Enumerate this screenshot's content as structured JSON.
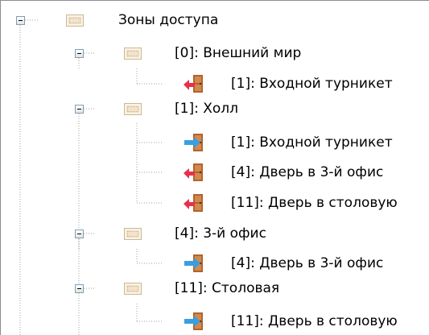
{
  "tree": {
    "root": {
      "label": "Зоны доступа"
    },
    "zones": [
      {
        "label": "[0]: Внешний мир",
        "doors": [
          {
            "label": "[1]: Входной турникет",
            "direction": "exit"
          }
        ]
      },
      {
        "label": "[1]: Холл",
        "doors": [
          {
            "label": "[1]: Входной турникет",
            "direction": "enter"
          },
          {
            "label": "[4]: Дверь в 3-й офис",
            "direction": "exit"
          },
          {
            "label": "[11]: Дверь в столовую",
            "direction": "exit"
          }
        ]
      },
      {
        "label": "[4]: 3-й офис",
        "doors": [
          {
            "label": "[4]: Дверь в 3-й офис",
            "direction": "enter"
          }
        ]
      },
      {
        "label": "[11]: Столовая",
        "doors": [
          {
            "label": "[11]: Дверь в столовую",
            "direction": "enter"
          }
        ]
      }
    ]
  },
  "colors": {
    "enter_arrow": "#3a9ee0",
    "exit_arrow": "#e8304a",
    "door": "#b4622a",
    "tree_lines": "#a0a0a0"
  }
}
